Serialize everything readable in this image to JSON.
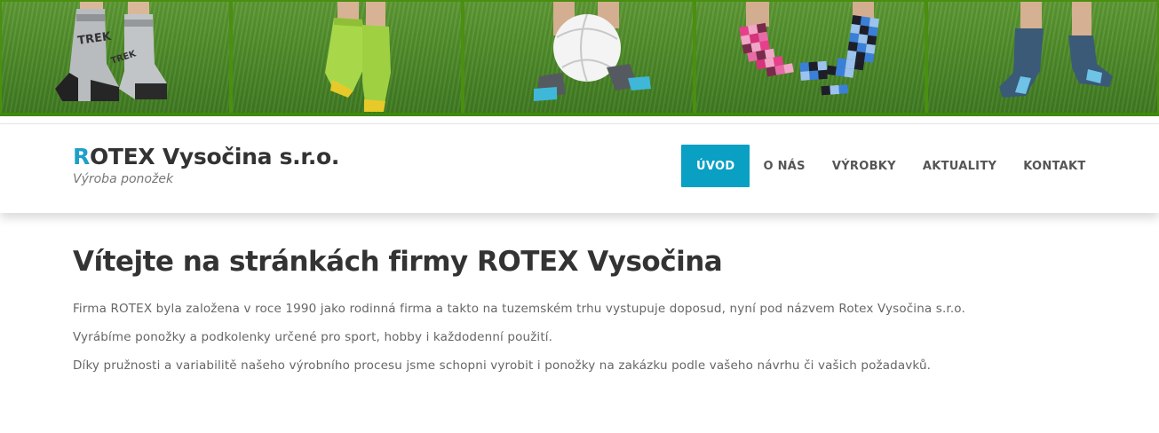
{
  "banner": {
    "photos": [
      {
        "name": "socks-trek-photo",
        "sock_text": "TREK"
      },
      {
        "name": "socks-green-photo"
      },
      {
        "name": "socks-ball-photo"
      },
      {
        "name": "socks-checkered-photo"
      },
      {
        "name": "socks-blue-photo"
      }
    ]
  },
  "header": {
    "logo_first_letter": "R",
    "logo_rest": "OTEX Vysočina s.r.o.",
    "tagline": "Výroba ponožek",
    "nav": [
      {
        "label": "ÚVOD",
        "active": true
      },
      {
        "label": "O NÁS",
        "active": false
      },
      {
        "label": "VÝROBKY",
        "active": false
      },
      {
        "label": "AKTUALITY",
        "active": false
      },
      {
        "label": "KONTAKT",
        "active": false
      }
    ]
  },
  "main": {
    "heading": "Vítejte na stránkách firmy ROTEX Vysočina",
    "paragraphs": [
      "Firma ROTEX byla založena v roce 1990 jako rodinná firma a takto na tuzemském trhu vystupuje doposud, nyní pod názvem Rotex Vysočina s.r.o.",
      "Vyrábíme ponožky a podkolenky určené pro sport, hobby i každodenní použití.",
      "Díky pružnosti a variabilitě našeho výrobního procesu jsme schopni vyrobit i ponožky na zakázku podle vašeho návrhu či vašich požadavků."
    ]
  },
  "colors": {
    "accent": "#0aa0c4",
    "logo_accent": "#1ea0c8",
    "banner_green": "#3f8a0c"
  }
}
